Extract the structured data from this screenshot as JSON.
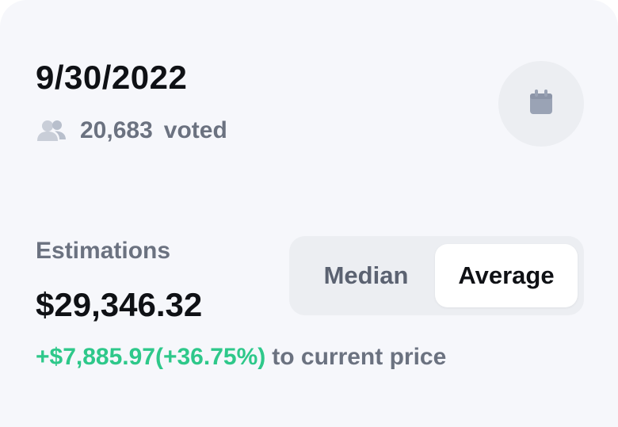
{
  "header": {
    "date": "9/30/2022",
    "vote_count": "20,683",
    "vote_label": "voted",
    "users_icon": "users-icon",
    "calendar_icon": "calendar-icon"
  },
  "estimations": {
    "label": "Estimations",
    "value": "$29,346.32",
    "change": "+$7,885.97(+36.75%)",
    "change_suffix": "to current price"
  },
  "mode_toggle": {
    "options": [
      "Median",
      "Average"
    ],
    "selected": "Average"
  },
  "colors": {
    "card_bg": "#f6f7fb",
    "positive": "#2ec88a",
    "muted": "#6b7280",
    "primary_text": "#0f1115",
    "toggle_bg": "#eceef2",
    "icon": "#9aa3b5"
  }
}
